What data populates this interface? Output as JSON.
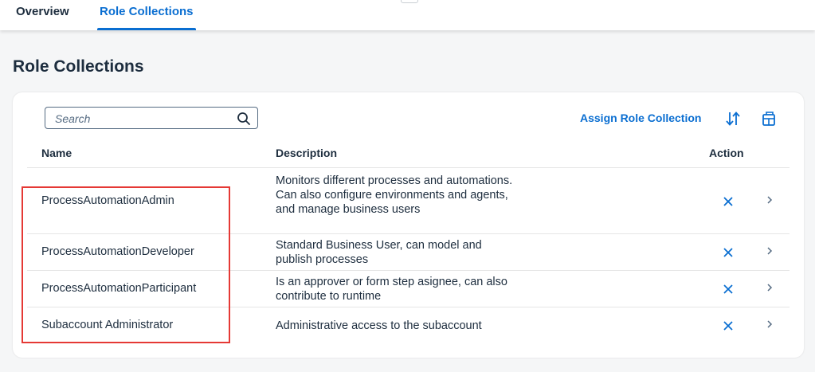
{
  "tabs": [
    {
      "label": "Overview",
      "selected": false
    },
    {
      "label": "Role Collections",
      "selected": true
    }
  ],
  "page_title": "Role Collections",
  "toolbar": {
    "search_placeholder": "Search",
    "assign_label": "Assign Role Collection",
    "sort_icon": "sort-icon",
    "settings_icon": "table-settings-icon"
  },
  "table": {
    "columns": [
      "Name",
      "Description",
      "Action"
    ],
    "rows": [
      {
        "name": "ProcessAutomationAdmin",
        "description": "Monitors different processes and automations. Can also configure environments and agents, and manage business users"
      },
      {
        "name": "ProcessAutomationDeveloper",
        "description": "Standard Business User, can model and publish processes"
      },
      {
        "name": "ProcessAutomationParticipant",
        "description": "Is an approver or form step asignee, can also contribute to runtime"
      },
      {
        "name": "Subaccount Administrator",
        "description": "Administrative access to the subaccount"
      }
    ]
  },
  "colors": {
    "accent": "#0a6ed1",
    "highlight_box": "#e53935",
    "background": "#f5f6f7"
  }
}
